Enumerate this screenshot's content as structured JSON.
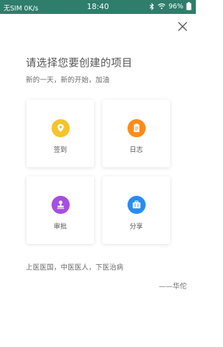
{
  "status_bar": {
    "carrier": "无SIM 0K/s",
    "time": "18:40",
    "battery": "96%"
  },
  "header": {
    "title": "请选择您要创建的项目",
    "subtitle": "新的一天，新的开始，加油"
  },
  "items": [
    {
      "label": "签到",
      "icon": "location-pin-icon",
      "color": "#f5c42c"
    },
    {
      "label": "日志",
      "icon": "notepad-icon",
      "color": "#fb8c1a"
    },
    {
      "label": "审批",
      "icon": "stamp-icon",
      "color": "#a64fe0"
    },
    {
      "label": "分享",
      "icon": "briefcase-icon",
      "color": "#2a8cf0"
    }
  ],
  "quote": {
    "text": "上医医国，中医医人，下医治病",
    "author": "——华佗"
  }
}
